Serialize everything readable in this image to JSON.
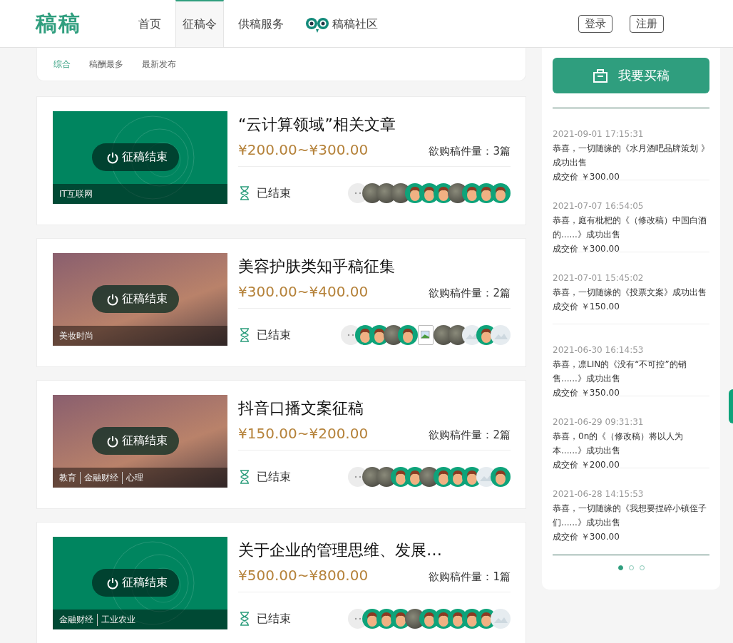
{
  "header": {
    "logo": "稿稿",
    "nav": [
      {
        "label": "首页",
        "selected": false,
        "icon": false
      },
      {
        "label": "征稿令",
        "selected": true,
        "icon": false
      },
      {
        "label": "供稿服务",
        "selected": false,
        "icon": false
      },
      {
        "label": "稿稿社区",
        "selected": false,
        "icon": true
      }
    ],
    "buttons": [
      "登录",
      "注册"
    ]
  },
  "filters": [
    {
      "label": "综合",
      "selected": true
    },
    {
      "label": "稿酬最多",
      "selected": false
    },
    {
      "label": "最新发布",
      "selected": false
    }
  ],
  "cards": [
    {
      "image": {
        "kind": "template",
        "badge": "征稿结束",
        "tags": [
          "IT互联网"
        ]
      },
      "title": "“云计算领域”相关文章",
      "price": "¥200.00~¥300.00",
      "quantity": "欲购稿件量：3篇",
      "status": "已结束",
      "avatars": [
        {
          "kind": "more"
        },
        {
          "kind": "photo"
        },
        {
          "kind": "photo"
        },
        {
          "kind": "photo"
        },
        {
          "kind": "default"
        },
        {
          "kind": "default"
        },
        {
          "kind": "default"
        },
        {
          "kind": "photo"
        },
        {
          "kind": "default"
        },
        {
          "kind": "default"
        },
        {
          "kind": "default"
        }
      ]
    },
    {
      "image": {
        "kind": "photo",
        "badge": "征稿结束",
        "tags": [
          "美妆时尚"
        ]
      },
      "title": "美容护肤类知乎稿征集",
      "price": "¥300.00~¥400.00",
      "quantity": "欲购稿件量：2篇",
      "status": "已结束",
      "avatars": [
        {
          "kind": "more"
        },
        {
          "kind": "default"
        },
        {
          "kind": "default"
        },
        {
          "kind": "photo"
        },
        {
          "kind": "default"
        },
        {
          "kind": "broken"
        },
        {
          "kind": "photo"
        },
        {
          "kind": "photo"
        },
        {
          "kind": "placeholder"
        },
        {
          "kind": "default"
        },
        {
          "kind": "placeholder"
        }
      ]
    },
    {
      "image": {
        "kind": "photo",
        "badge": "征稿结束",
        "tags": [
          "教育",
          "金融财经",
          "心理"
        ]
      },
      "title": "抖音口播文案征稿",
      "price": "¥150.00~¥200.00",
      "quantity": "欲购稿件量：2篇",
      "status": "已结束",
      "avatars": [
        {
          "kind": "more"
        },
        {
          "kind": "photo"
        },
        {
          "kind": "photo"
        },
        {
          "kind": "default"
        },
        {
          "kind": "default"
        },
        {
          "kind": "photo"
        },
        {
          "kind": "default"
        },
        {
          "kind": "default"
        },
        {
          "kind": "default"
        },
        {
          "kind": "placeholder"
        },
        {
          "kind": "default"
        }
      ]
    },
    {
      "image": {
        "kind": "template",
        "badge": "征稿结束",
        "tags": [
          "金融财经",
          "工业农业"
        ]
      },
      "title": "关于企业的管理思维、发展…",
      "price": "¥500.00~¥800.00",
      "quantity": "欲购稿件量：1篇",
      "status": "已结束",
      "avatars": [
        {
          "kind": "more"
        },
        {
          "kind": "default"
        },
        {
          "kind": "default"
        },
        {
          "kind": "default"
        },
        {
          "kind": "photo"
        },
        {
          "kind": "default"
        },
        {
          "kind": "default"
        },
        {
          "kind": "default"
        },
        {
          "kind": "default"
        },
        {
          "kind": "default"
        },
        {
          "kind": "placeholder"
        }
      ]
    }
  ],
  "sidebar": {
    "buy_button": "我要买稿",
    "feed": [
      {
        "time": "2021-09-01 17:15:31",
        "text": "恭喜，一切随缘的《水月酒吧品牌策划 》成功出售",
        "price": "成交价 ￥300.00"
      },
      {
        "time": "2021-07-07 16:54:05",
        "text": "恭喜，庭有枇杷的《（修改稿）中国白酒的......》成功出售",
        "price": "成交价 ￥300.00"
      },
      {
        "time": "2021-07-01 15:45:02",
        "text": "恭喜，一切随缘的《投票文案》成功出售",
        "price": "成交价 ￥150.00"
      },
      {
        "time": "2021-06-30 16:14:53",
        "text": "恭喜，凛LIN的《没有“不可控”的销售......》成功出售",
        "price": "成交价 ￥350.00"
      },
      {
        "time": "2021-06-29 09:31:31",
        "text": "恭喜，0n的《（修改稿）将以人为本......》成功出售",
        "price": "成交价 ￥200.00"
      },
      {
        "time": "2021-06-28 14:15:53",
        "text": "恭喜，一切随缘的《我想要捏碎小镇侄子们......》成功出售",
        "price": "成交价 ￥300.00"
      }
    ],
    "pager": [
      {
        "selected": true
      },
      {
        "selected": false
      },
      {
        "selected": false
      }
    ]
  }
}
